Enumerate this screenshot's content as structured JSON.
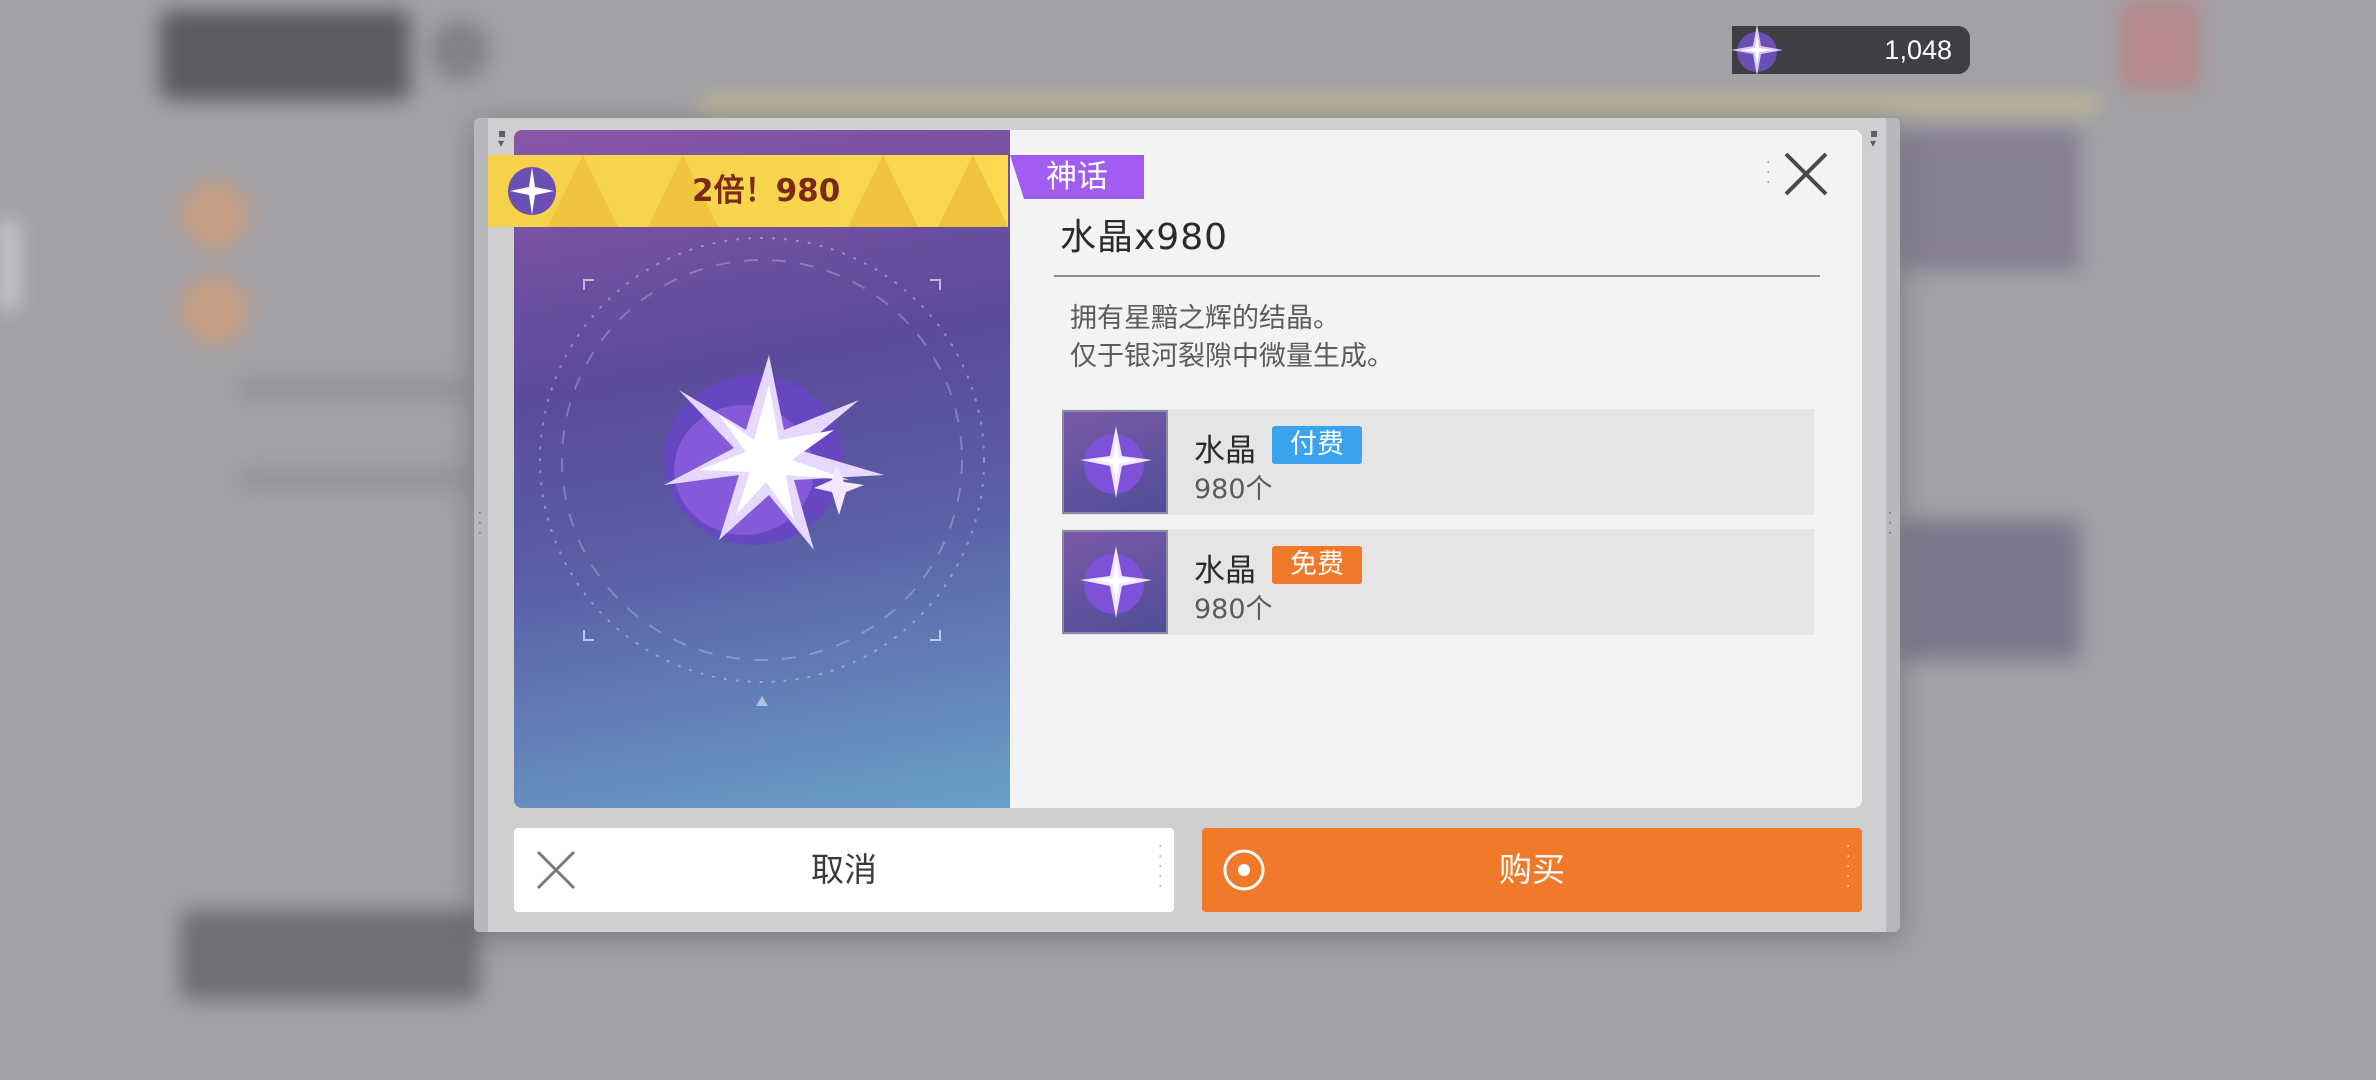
{
  "currency": {
    "icon": "crystal-icon",
    "value": "1,048"
  },
  "item": {
    "rarity": "神话",
    "title": "水晶x980",
    "bonus_label": "2倍！980",
    "description_lines": [
      "拥有星黯之辉的结晶。",
      "仅于银河裂隙中微量生成。"
    ]
  },
  "breakdown": [
    {
      "name": "水晶",
      "tag": "付费",
      "tag_color": "#3aa2ee",
      "count": "980个"
    },
    {
      "name": "水晶",
      "tag": "免费",
      "tag_color": "#f07a2a",
      "count": "980个"
    }
  ],
  "buttons": {
    "cancel": "取消",
    "buy": "购买"
  },
  "colors": {
    "accent": "#f07a2a",
    "rarity": "#a25cf1",
    "paid": "#3aa2ee"
  }
}
